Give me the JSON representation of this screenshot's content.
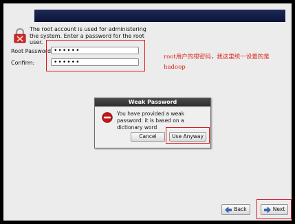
{
  "intro_text": "The root account is used for administering the system.  Enter a password for the root user.",
  "form": {
    "root_password_label": "Root Password:",
    "root_password_value": "••••••",
    "confirm_label": "Confirm:",
    "confirm_value": "••••••"
  },
  "annotation": {
    "text": "root用户的根密码，我这里统一设置的是hadoop",
    "color": "#d9261c"
  },
  "dialog": {
    "title": "Weak Password",
    "message": "You have provided a weak password: it is based on a dictionary word",
    "cancel_label": "Cancel",
    "use_anyway_label": "Use Anyway"
  },
  "nav": {
    "back_label": "Back",
    "next_label": "Next"
  },
  "colors": {
    "highlight": "#e0161b",
    "header_bar": "#1e2a56",
    "stop_icon": "#c8161d"
  },
  "icons": [
    "lock-icon",
    "stop-icon",
    "back-arrow-icon",
    "next-arrow-icon"
  ]
}
